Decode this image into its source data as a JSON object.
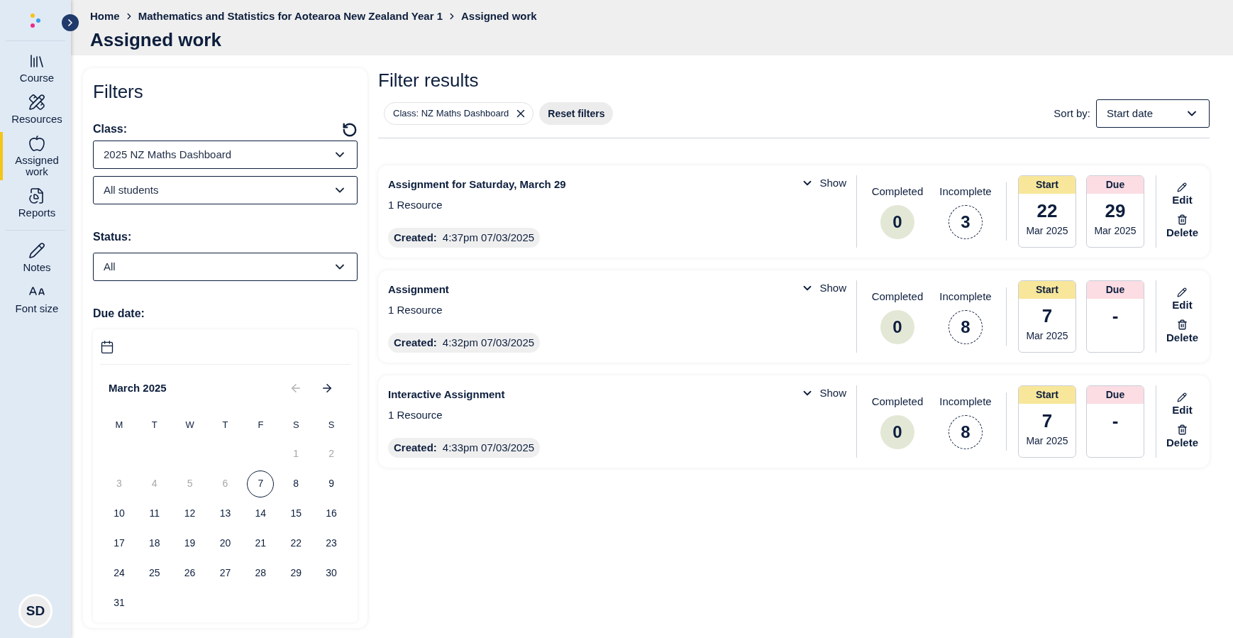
{
  "sidebar": {
    "sections": [
      {
        "items": [
          {
            "kind": "books",
            "label": "Course",
            "selected": false
          },
          {
            "kind": "resources",
            "label": "Resources",
            "selected": false
          },
          {
            "kind": "apple",
            "label": "Assigned work",
            "selected": true
          },
          {
            "kind": "report",
            "label": "Reports",
            "selected": false
          }
        ]
      },
      {
        "items": [
          {
            "kind": "pencil",
            "label": "Notes",
            "selected": false
          },
          {
            "kind": "font",
            "label": "Font size",
            "selected": false
          }
        ]
      }
    ],
    "avatar": "SD"
  },
  "breadcrumb": [
    "Home",
    "Mathematics and Statistics for Aotearoa New Zealand Year 1",
    "Assigned work"
  ],
  "page_title": "Assigned work",
  "filters": {
    "title": "Filters",
    "class_label": "Class:",
    "class_value": "2025 NZ Maths Dashboard",
    "students_value": "All students",
    "status_label": "Status:",
    "status_value": "All",
    "due_date_label": "Due date:",
    "calendar": {
      "month": "March 2025",
      "prev_disabled": true,
      "weekdays": [
        "M",
        "T",
        "W",
        "T",
        "F",
        "S",
        "S"
      ],
      "days": [
        {
          "day": "1",
          "disabled": true,
          "selected": false
        },
        {
          "day": "2",
          "disabled": true,
          "selected": false
        },
        {
          "day": "3",
          "disabled": true,
          "selected": false
        },
        {
          "day": "4",
          "disabled": true,
          "selected": false
        },
        {
          "day": "5",
          "disabled": true,
          "selected": false
        },
        {
          "day": "6",
          "disabled": true,
          "selected": false
        },
        {
          "day": "7",
          "disabled": false,
          "selected": true
        },
        {
          "day": "8",
          "disabled": false,
          "selected": false
        },
        {
          "day": "9",
          "disabled": false,
          "selected": false
        },
        {
          "day": "10",
          "disabled": false,
          "selected": false
        },
        {
          "day": "11",
          "disabled": false,
          "selected": false
        },
        {
          "day": "12",
          "disabled": false,
          "selected": false
        },
        {
          "day": "13",
          "disabled": false,
          "selected": false
        },
        {
          "day": "14",
          "disabled": false,
          "selected": false
        },
        {
          "day": "15",
          "disabled": false,
          "selected": false
        },
        {
          "day": "16",
          "disabled": false,
          "selected": false
        },
        {
          "day": "17",
          "disabled": false,
          "selected": false
        },
        {
          "day": "18",
          "disabled": false,
          "selected": false
        },
        {
          "day": "19",
          "disabled": false,
          "selected": false
        },
        {
          "day": "20",
          "disabled": false,
          "selected": false
        },
        {
          "day": "21",
          "disabled": false,
          "selected": false
        },
        {
          "day": "22",
          "disabled": false,
          "selected": false
        },
        {
          "day": "23",
          "disabled": false,
          "selected": false
        },
        {
          "day": "24",
          "disabled": false,
          "selected": false
        },
        {
          "day": "25",
          "disabled": false,
          "selected": false
        },
        {
          "day": "26",
          "disabled": false,
          "selected": false
        },
        {
          "day": "27",
          "disabled": false,
          "selected": false
        },
        {
          "day": "28",
          "disabled": false,
          "selected": false
        },
        {
          "day": "29",
          "disabled": false,
          "selected": false
        },
        {
          "day": "30",
          "disabled": false,
          "selected": false
        },
        {
          "day": "31",
          "disabled": false,
          "selected": false
        }
      ]
    }
  },
  "results": {
    "title": "Filter results",
    "chips": [
      {
        "label": "Class: NZ Maths Dashboard"
      }
    ],
    "reset_button": "Reset filters",
    "sort_label": "Sort by:",
    "sort_value": "Start date",
    "assignments": [
      {
        "title": "Assignment for Saturday, March 29",
        "resources": "1 Resource",
        "show": "Show",
        "created_label": "Created:",
        "created": "4:37pm 07/03/2025",
        "completed_label": "Completed",
        "completed": "0",
        "incomplete_label": "Incomplete",
        "incomplete": "3",
        "start": {
          "label": "Start",
          "day": "22",
          "month": "Mar 2025"
        },
        "due": {
          "label": "Due",
          "day": "29",
          "month": "Mar 2025"
        },
        "edit": "Edit",
        "delete": "Delete"
      },
      {
        "title": "Assignment",
        "resources": "1 Resource",
        "show": "Show",
        "created_label": "Created:",
        "created": "4:32pm 07/03/2025",
        "completed_label": "Completed",
        "completed": "0",
        "incomplete_label": "Incomplete",
        "incomplete": "8",
        "start": {
          "label": "Start",
          "day": "7",
          "month": "Mar 2025"
        },
        "due": {
          "label": "Due",
          "day": "-"
        },
        "edit": "Edit",
        "delete": "Delete"
      },
      {
        "title": "Interactive Assignment",
        "resources": "1 Resource",
        "show": "Show",
        "created_label": "Created:",
        "created": "4:33pm 07/03/2025",
        "completed_label": "Completed",
        "completed": "0",
        "incomplete_label": "Incomplete",
        "incomplete": "8",
        "start": {
          "label": "Start",
          "day": "7",
          "month": "Mar 2025"
        },
        "due": {
          "label": "Due",
          "day": "-"
        },
        "edit": "Edit",
        "delete": "Delete"
      }
    ]
  }
}
